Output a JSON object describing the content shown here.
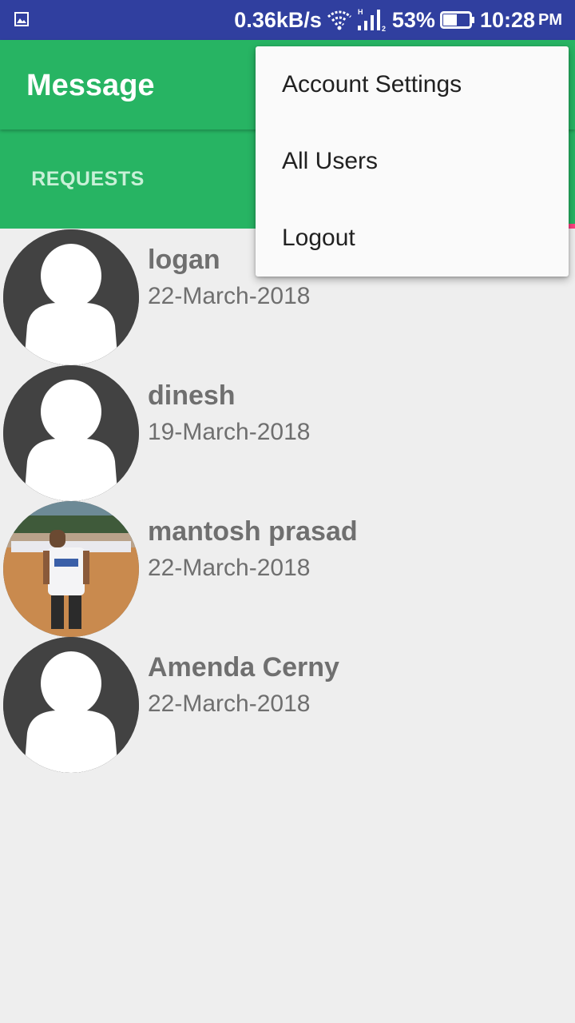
{
  "status_bar": {
    "net_speed": "0.36kB/s",
    "battery_percent": "53%",
    "time": "10:28",
    "ampm": "PM",
    "battery_level": 0.53,
    "icons": [
      "gallery-icon",
      "wifi-icon",
      "signal-icon",
      "battery-icon"
    ]
  },
  "app_bar": {
    "title": "Message",
    "background": "#27b463"
  },
  "tabs": [
    {
      "label": "REQUESTS"
    },
    {
      "label": ""
    },
    {
      "label": ""
    }
  ],
  "menu": {
    "items": [
      {
        "label": "Account Settings"
      },
      {
        "label": "All Users"
      },
      {
        "label": "Logout"
      }
    ]
  },
  "users": [
    {
      "name": "logan",
      "date": "22-March-2018",
      "avatar": "default-avatar-icon"
    },
    {
      "name": "dinesh",
      "date": "19-March-2018",
      "avatar": "default-avatar-icon"
    },
    {
      "name": "mantosh prasad",
      "date": "22-March-2018",
      "avatar": "profile-photo"
    },
    {
      "name": "Amenda Cerny",
      "date": "22-March-2018",
      "avatar": "default-avatar-icon"
    }
  ],
  "colors": {
    "status_bar": "#303f9f",
    "primary": "#27b463",
    "accent": "#ff4081",
    "list_background": "#eeeeee",
    "avatar_background": "#424242"
  }
}
